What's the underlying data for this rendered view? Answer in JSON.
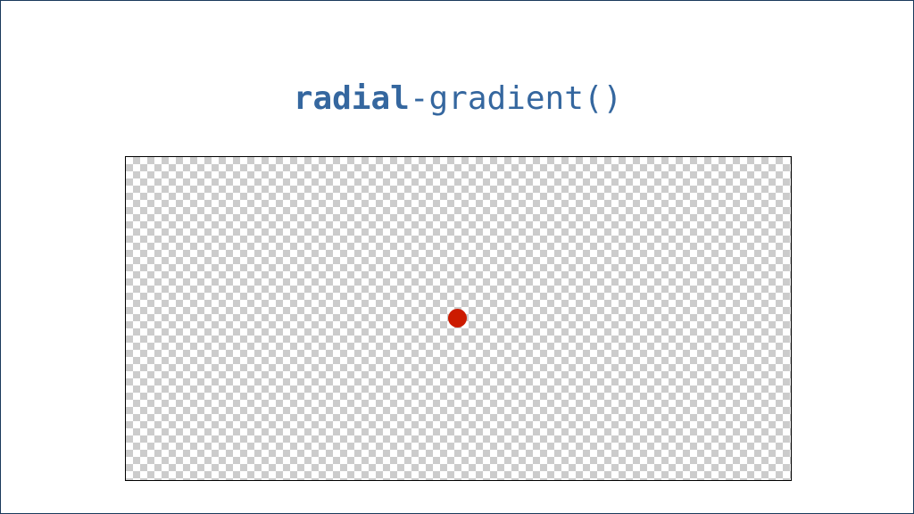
{
  "title": {
    "keyword": "radial",
    "rest": "-gradient()"
  },
  "colors": {
    "title": "#35679f",
    "frame_border": "#1a3a5c",
    "checker_dark": "#cccccc",
    "checker_light": "#ffffff",
    "center_point": "#cc1b00"
  },
  "diagram": {
    "center_point_icon": "gradient-center-point"
  }
}
